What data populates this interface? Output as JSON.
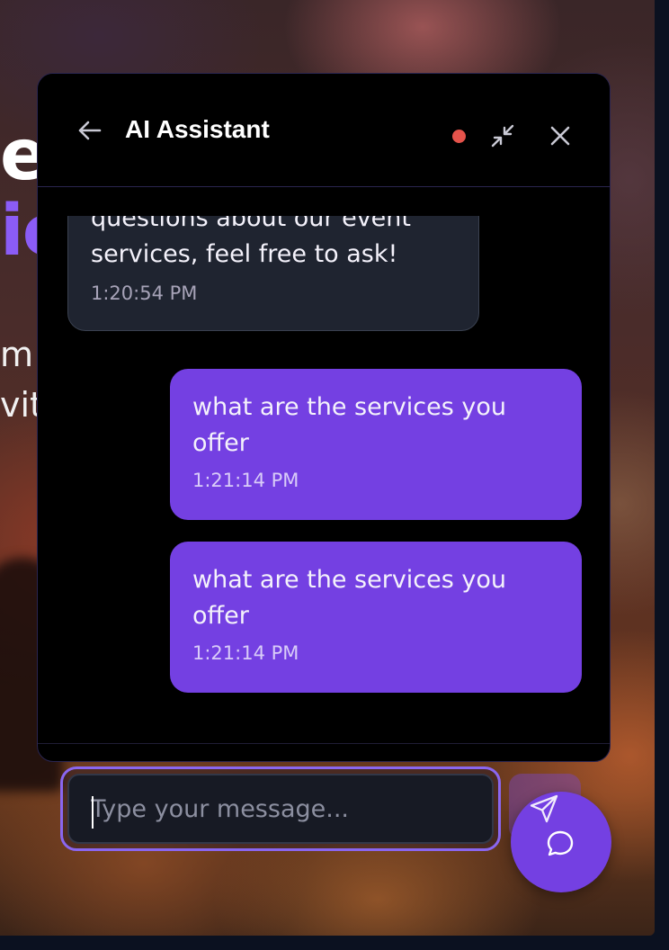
{
  "background": {
    "hero_line_1": "er",
    "hero_line_2": "ic",
    "hero_line_3": "m",
    "hero_line_4": "vit"
  },
  "chat": {
    "title": "AI Assistant",
    "status_color": "#e5534b",
    "accent_color": "#7440e2",
    "icons": {
      "back": "arrow-left-icon",
      "minimize": "minimize-icon",
      "close": "close-icon",
      "send": "send-icon",
      "fab": "chat-bubble-icon"
    },
    "messages": [
      {
        "role": "assistant",
        "text": "questions about our event services, feel free to ask!",
        "time": "1:20:54 PM"
      },
      {
        "role": "user",
        "text": "what are the services you offer",
        "time": "1:21:14 PM"
      },
      {
        "role": "user",
        "text": "what are the services you offer",
        "time": "1:21:14 PM"
      }
    ],
    "input": {
      "placeholder": "Type your message...",
      "value": ""
    }
  }
}
